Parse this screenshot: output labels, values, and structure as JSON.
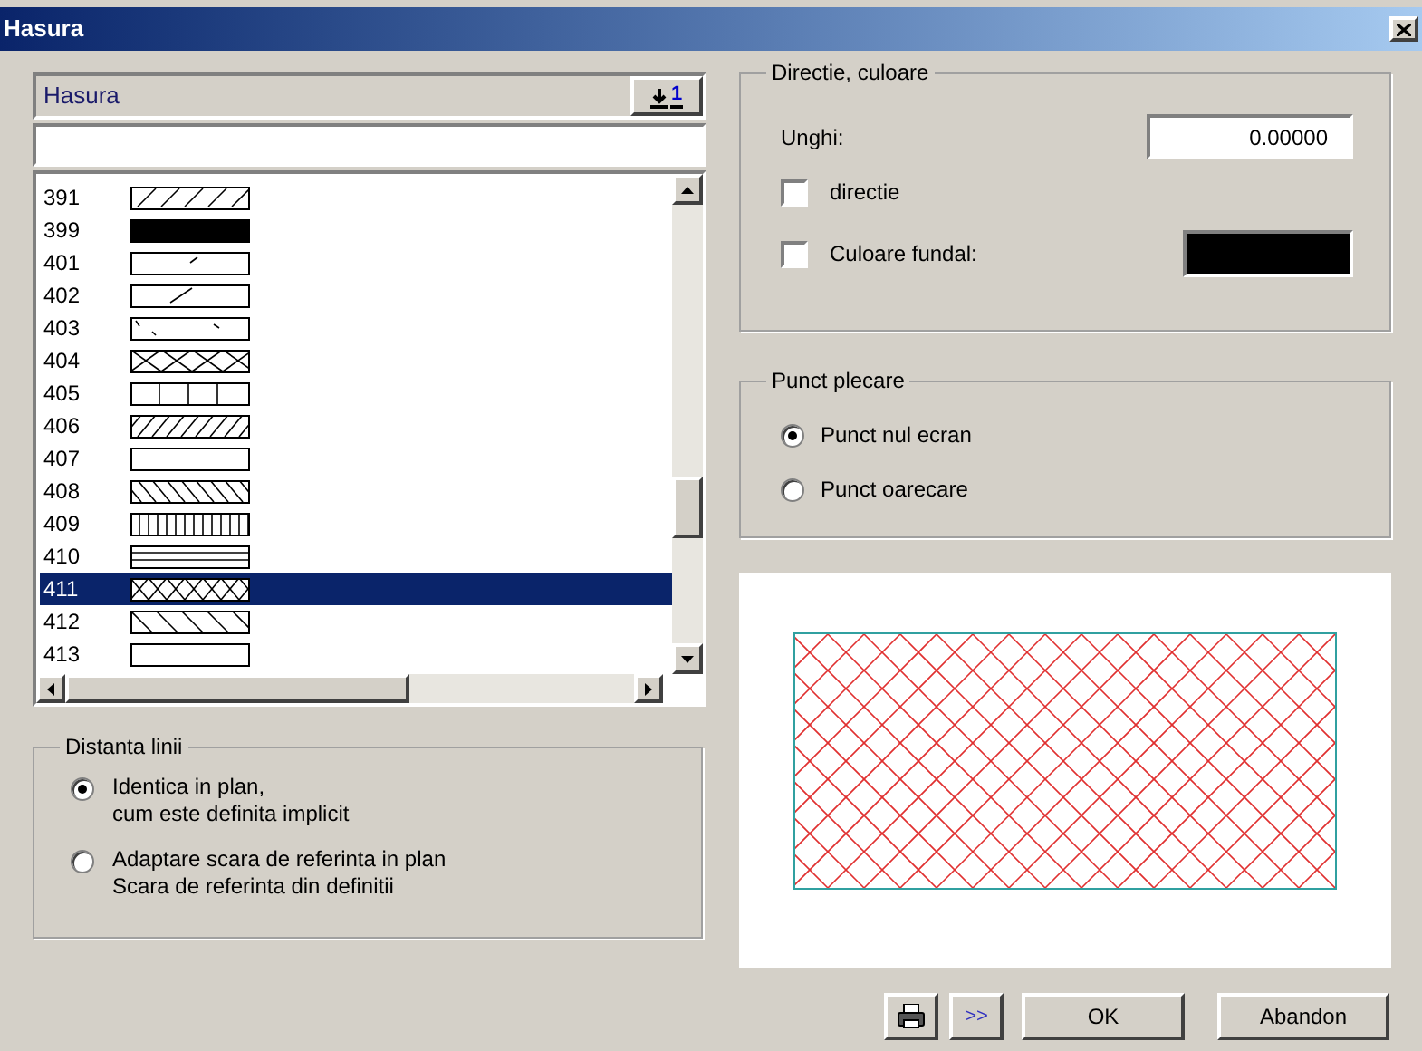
{
  "window": {
    "title": "Hasura"
  },
  "hatch_list": {
    "header": "Hasura",
    "header_button": "1",
    "rows": [
      {
        "code": "391",
        "kind": "diag",
        "selected": false
      },
      {
        "code": "399",
        "kind": "solid",
        "selected": false
      },
      {
        "code": "401",
        "kind": "tick",
        "selected": false
      },
      {
        "code": "402",
        "kind": "single",
        "selected": false
      },
      {
        "code": "403",
        "kind": "dots",
        "selected": false
      },
      {
        "code": "404",
        "kind": "cross",
        "selected": false
      },
      {
        "code": "405",
        "kind": "grid",
        "selected": false
      },
      {
        "code": "406",
        "kind": "dense",
        "selected": false
      },
      {
        "code": "407",
        "kind": "empty",
        "selected": false
      },
      {
        "code": "408",
        "kind": "back",
        "selected": false
      },
      {
        "code": "409",
        "kind": "vertical",
        "selected": false
      },
      {
        "code": "410",
        "kind": "horizontal",
        "selected": false
      },
      {
        "code": "411",
        "kind": "crosshatch",
        "selected": true
      },
      {
        "code": "412",
        "kind": "backsparse",
        "selected": false
      },
      {
        "code": "413",
        "kind": "empty",
        "selected": false
      }
    ]
  },
  "line_spacing": {
    "title": "Distanta linii",
    "options": [
      {
        "lines": [
          "Identica in plan,",
          "cum este definita implicit"
        ],
        "selected": true
      },
      {
        "lines": [
          "Adaptare scara de referinta in plan",
          "Scara de referinta din definitii"
        ],
        "selected": false
      }
    ]
  },
  "direction_color": {
    "title": "Directie, culoare",
    "angle_label": "Unghi:",
    "angle_value": "0.00000",
    "direction": {
      "label": "directie",
      "checked": false
    },
    "background": {
      "label": "Culoare fundal:",
      "checked": false,
      "color": "#000000"
    }
  },
  "start_point": {
    "title": "Punct plecare",
    "options": [
      {
        "label": "Punct nul ecran",
        "selected": true
      },
      {
        "label": "Punct oarecare",
        "selected": false
      }
    ]
  },
  "buttons": {
    "more": ">>",
    "ok": "OK",
    "cancel": "Abandon"
  }
}
